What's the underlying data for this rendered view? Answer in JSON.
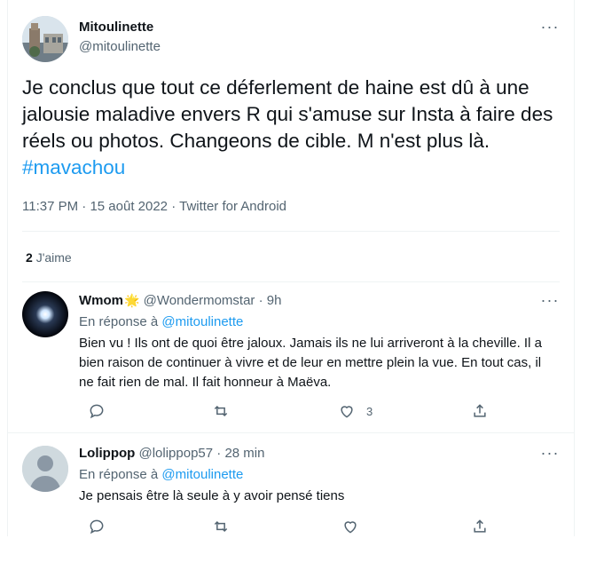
{
  "tweet": {
    "author_name": "Mitoulinette",
    "author_handle": "@mitoulinette",
    "text": "Je conclus que tout ce déferlement de haine est dû à une jalousie maladive envers R qui s'amuse sur Insta à faire des réels ou photos. Changeons de cible. M n'est plus là.",
    "hashtag": "#mavachou",
    "time": "11:37 PM",
    "date": "15 août 2022",
    "source": "Twitter for Android",
    "likes_count": "2",
    "likes_label": "J'aime"
  },
  "replies": [
    {
      "name": "Wmom",
      "badge": "🌟",
      "handle": "@Wondermomstar",
      "age": "9h",
      "in_reply_prefix": "En réponse à",
      "mention": "@mitoulinette",
      "text": "Bien vu ! Ils ont de quoi être jaloux. Jamais ils ne lui arriveront à la cheville. Il a bien raison de continuer à vivre et de leur en mettre plein la vue. En tout cas, il ne fait rien de mal. Il fait honneur à Maëva.",
      "like_count": "3"
    },
    {
      "name": "Lolippop",
      "handle": "@lolippop57",
      "age": "28 min",
      "in_reply_prefix": "En réponse à",
      "mention": "@mitoulinette",
      "text": "Je pensais être là seule à y avoir pensé tiens"
    }
  ],
  "separators": {
    "dot": "·",
    "more": "···"
  },
  "colors": {
    "accent": "#1d9bf0",
    "muted": "#536471",
    "text": "#0f1419",
    "divider": "#eff3f4"
  },
  "icons": [
    "more-icon",
    "reply-icon",
    "retweet-icon",
    "like-icon",
    "share-icon",
    "star-badge-icon"
  ]
}
